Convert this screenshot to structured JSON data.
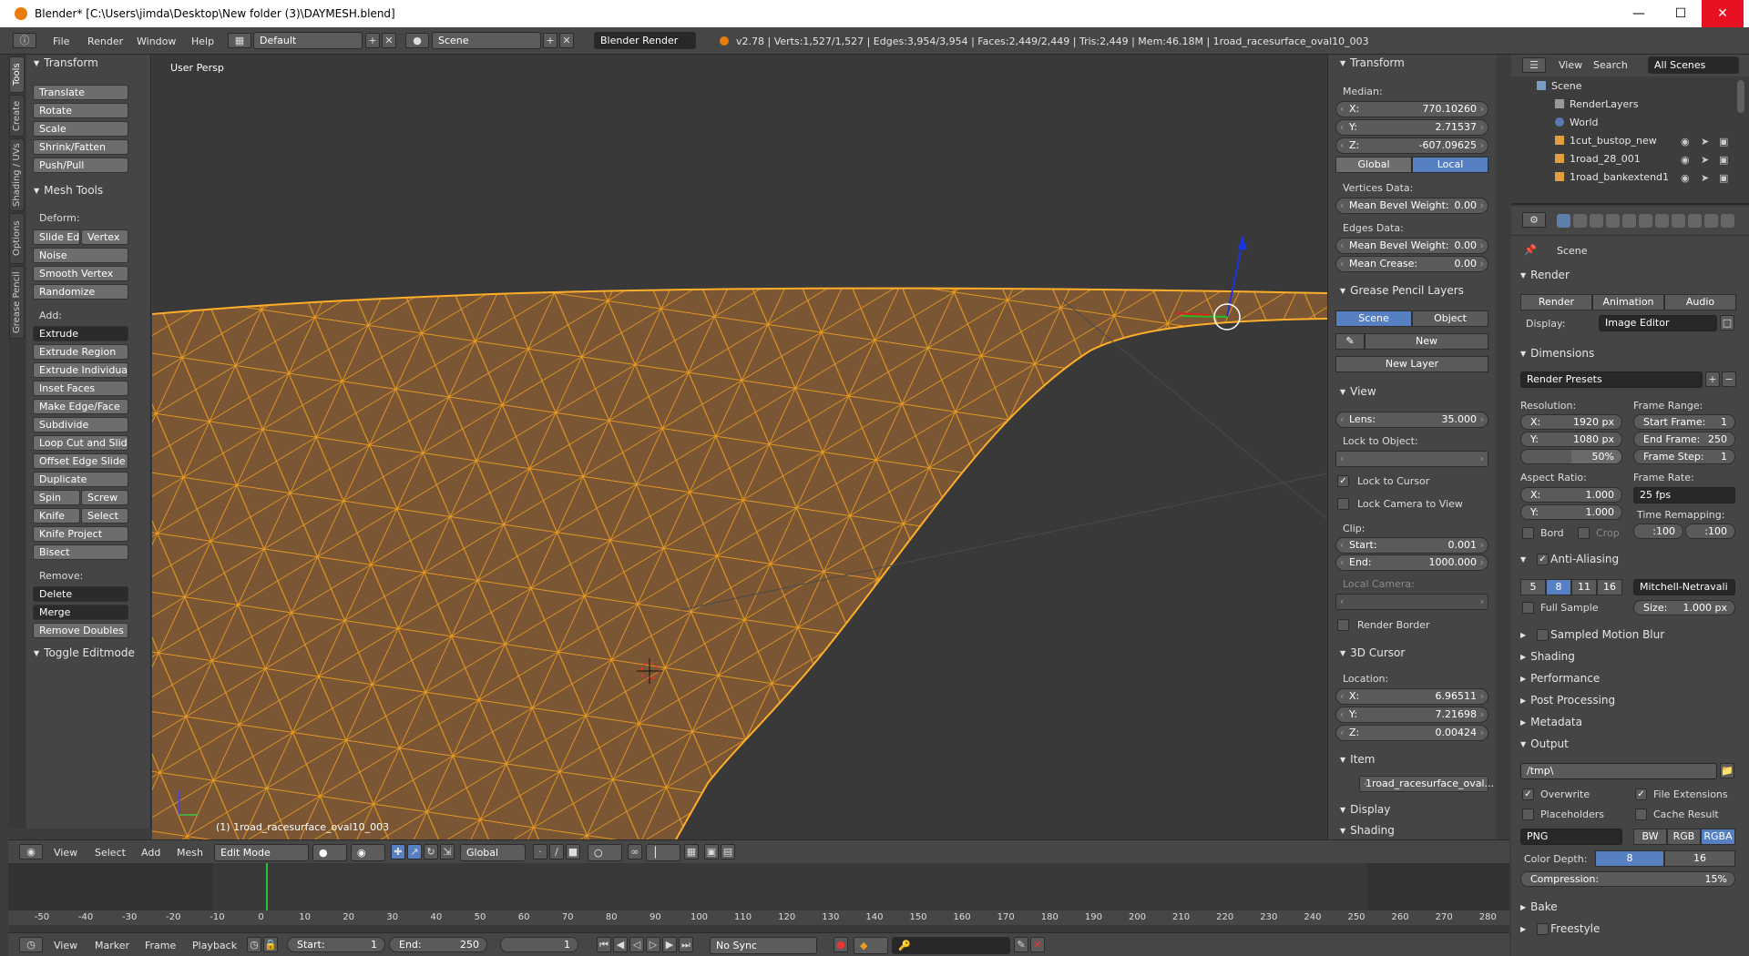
{
  "window": {
    "title": "Blender* [C:\\Users\\jimda\\Desktop\\New folder (3)\\DAYMESH.blend]",
    "min": "—",
    "max": "☐",
    "close": "✕"
  },
  "menubar": {
    "items": [
      "File",
      "Render",
      "Window",
      "Help"
    ],
    "layout": "Default",
    "scene": "Scene",
    "engine": "Blender Render",
    "stats": "v2.78 | Verts:1,527/1,527 | Edges:3,954/3,954 | Faces:2,449/2,449 | Tris:2,449 | Mem:46.18M | 1road_racesurface_oval10_003"
  },
  "toolshelf": {
    "tabs": [
      "Tools",
      "Create",
      "Shading / UVs",
      "Options",
      "Grease Pencil"
    ],
    "transform": {
      "title": "Transform",
      "buttons": [
        "Translate",
        "Rotate",
        "Scale",
        "Shrink/Fatten",
        "Push/Pull"
      ]
    },
    "meshtools": {
      "title": "Mesh Tools",
      "deform_label": "Deform:",
      "slide_edge": "Slide Ed",
      "vertex": "Vertex",
      "deform": [
        "Noise",
        "Smooth Vertex",
        "Randomize"
      ],
      "add_label": "Add:",
      "extrude": "Extrude",
      "add": [
        "Extrude Region",
        "Extrude Individual",
        "Inset Faces",
        "Make Edge/Face",
        "Subdivide",
        "Loop Cut and Slide",
        "Offset Edge Slide",
        "Duplicate"
      ],
      "spin": "Spin",
      "screw": "Screw",
      "knife": "Knife",
      "select": "Select",
      "knife_project": "Knife Project",
      "bisect": "Bisect",
      "remove_label": "Remove:",
      "delete": "Delete",
      "merge": "Merge",
      "remove_doubles": "Remove Doubles"
    },
    "toggle_editmode": "Toggle Editmode"
  },
  "viewport": {
    "label": "User Persp",
    "object_label": "(1) 1road_racesurface_oval10_003"
  },
  "npanel": {
    "transform": {
      "title": "Transform",
      "median": "Median:",
      "x": "770.10260",
      "y": "2.71537",
      "z": "-607.09625",
      "global": "Global",
      "local": "Local",
      "vertices_data": "Vertices Data:",
      "mean_bevel_weight_label": "Mean Bevel Weight:",
      "vert_bevel": "0.00",
      "edges_data": "Edges Data:",
      "edge_bevel": "0.00",
      "mean_crease_label": "Mean Crease:",
      "mean_crease": "0.00"
    },
    "grease": {
      "title": "Grease Pencil Layers",
      "scene": "Scene",
      "object": "Object",
      "new": "New",
      "new_layer": "New Layer"
    },
    "view": {
      "title": "View",
      "lens_label": "Lens:",
      "lens": "35.000",
      "lock_object": "Lock to Object:",
      "lock_cursor": "Lock to Cursor",
      "lock_camera": "Lock Camera to View",
      "clip": "Clip:",
      "start_label": "Start:",
      "start": "0.001",
      "end_label": "End:",
      "end": "1000.000",
      "local_camera": "Local Camera:",
      "render_border": "Render Border"
    },
    "cursor": {
      "title": "3D Cursor",
      "location": "Location:",
      "x": "6.96511",
      "y": "7.21698",
      "z": "0.00424"
    },
    "item": {
      "title": "Item",
      "name": "1road_racesurface_oval..."
    },
    "display": "Display",
    "shading": "Shading"
  },
  "outliner": {
    "view": "View",
    "search": "Search",
    "filter": "All Scenes",
    "rows": [
      "Scene",
      "RenderLayers",
      "World",
      "1cut_bustop_new",
      "1road_28_001",
      "1road_bankextend1"
    ]
  },
  "props": {
    "breadcrumb": "Scene",
    "render": {
      "title": "Render",
      "render_btn": "Render",
      "animation_btn": "Animation",
      "audio_btn": "Audio",
      "display_label": "Display:",
      "display": "Image Editor"
    },
    "dimensions": {
      "title": "Dimensions",
      "presets": "Render Presets",
      "resolution": "Resolution:",
      "res_x": "1920 px",
      "res_y": "1080 px",
      "res_pct": "50%",
      "frame_range": "Frame Range:",
      "start_frame_label": "Start Frame:",
      "start_frame": "1",
      "end_frame_label": "End Frame:",
      "end_frame": "250",
      "frame_step_label": "Frame Step:",
      "frame_step": "1",
      "aspect": "Aspect Ratio:",
      "asp_x": "1.000",
      "asp_y": "1.000",
      "frame_rate": "Frame Rate:",
      "fps": "25 fps",
      "time_remap": "Time Remapping:",
      "remap_old": ":100",
      "remap_new": ":100",
      "bord": "Bord",
      "crop": "Crop"
    },
    "aa": {
      "title": "Anti-Aliasing",
      "s5": "5",
      "s8": "8",
      "s11": "11",
      "s16": "16",
      "filter": "Mitchell-Netravali",
      "full_sample": "Full Sample",
      "size_label": "Size:",
      "size": "1.000 px"
    },
    "collapsed": [
      "Sampled Motion Blur",
      "Shading",
      "Performance",
      "Post Processing",
      "Metadata"
    ],
    "output": {
      "title": "Output",
      "path": "/tmp\\",
      "overwrite": "Overwrite",
      "file_ext": "File Extensions",
      "placeholders": "Placeholders",
      "cache": "Cache Result",
      "format": "PNG",
      "bw": "BW",
      "rgb": "RGB",
      "rgba": "RGBA",
      "depth_label": "Color Depth:",
      "d8": "8",
      "d16": "16",
      "compression_label": "Compression:",
      "compression": "15%"
    },
    "bake": "Bake",
    "freestyle": "Freestyle"
  },
  "hdr3d": {
    "items": [
      "View",
      "Select",
      "Add",
      "Mesh"
    ],
    "mode": "Edit Mode",
    "orientation": "Global"
  },
  "timeline": {
    "ticks": [
      "-50",
      "-40",
      "-30",
      "-20",
      "-10",
      "0",
      "10",
      "20",
      "30",
      "40",
      "50",
      "60",
      "70",
      "80",
      "90",
      "100",
      "110",
      "120",
      "130",
      "140",
      "150",
      "160",
      "170",
      "180",
      "190",
      "200",
      "210",
      "220",
      "230",
      "240",
      "250",
      "260",
      "270",
      "280"
    ],
    "menu": [
      "View",
      "Marker",
      "Frame",
      "Playback"
    ],
    "start_label": "Start:",
    "start": "1",
    "end_label": "End:",
    "end": "250",
    "current": "1",
    "sync": "No Sync"
  }
}
